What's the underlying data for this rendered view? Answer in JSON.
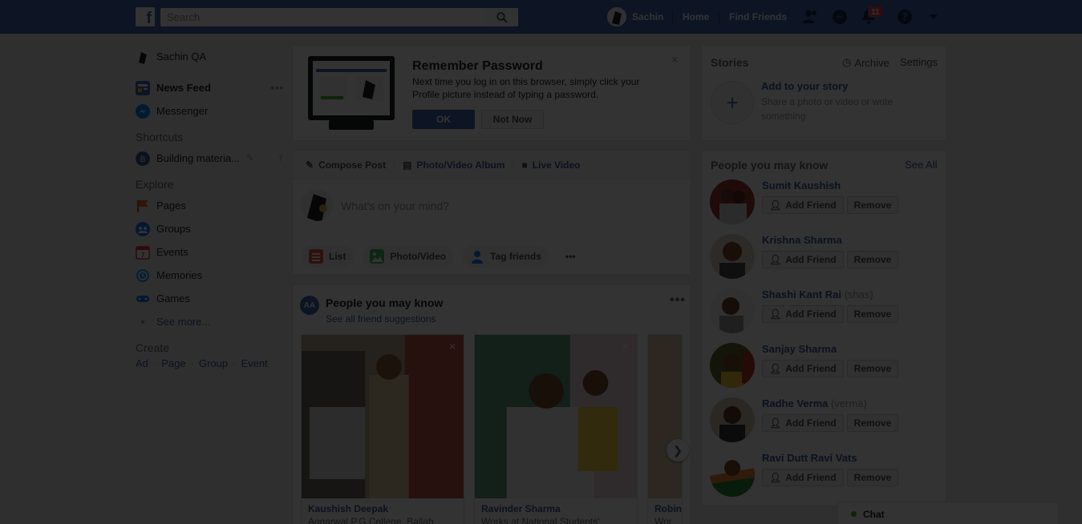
{
  "topbar": {
    "logo": "f",
    "search_placeholder": "Search",
    "user_name": "Sachin",
    "home": "Home",
    "find_friends": "Find Friends",
    "notifications_count": "11"
  },
  "left": {
    "profile_name": "Sachin QA",
    "news_feed": "News Feed",
    "news_feed_more": "•••",
    "messenger": "Messenger",
    "shortcuts_label": "Shortcuts",
    "shortcut_item": "Building materia...",
    "shortcut_count": "7",
    "explore_label": "Explore",
    "explore": [
      "Pages",
      "Groups",
      "Events",
      "Memories",
      "Games"
    ],
    "see_more": "See more...",
    "create_label": "Create",
    "create_links": [
      "Ad",
      "Page",
      "Group",
      "Event"
    ]
  },
  "remember_password": {
    "title": "Remember Password",
    "text": "Next time you log in on this browser, simply click your Profile picture instead of typing a password.",
    "ok": "OK",
    "not_now": "Not Now",
    "close": "×"
  },
  "composer": {
    "tabs": [
      "Compose Post",
      "Photo/Video Album",
      "Live Video"
    ],
    "placeholder": "What's on your mind?",
    "actions": [
      "List",
      "Photo/Video",
      "Tag friends"
    ],
    "more": "•••"
  },
  "pymk_feed": {
    "icon": "AA",
    "title": "People you may know",
    "subtitle": "See all friend suggestions",
    "more": "•••",
    "cards": [
      {
        "name": "Kaushish Deepak",
        "work": "Aggarwal P.G.College, Ballab"
      },
      {
        "name": "Ravinder Sharma",
        "work": "Works at National Students'"
      },
      {
        "name": "Robin",
        "work": "Wor"
      }
    ]
  },
  "stories": {
    "title": "Stories",
    "archive": "Archive",
    "settings": "Settings",
    "add_title": "Add to your story",
    "add_desc": "Share a photo or video or write something"
  },
  "pymk_right": {
    "title": "People you may know",
    "see_all": "See All",
    "add_friend": "Add Friend",
    "remove": "Remove",
    "people": [
      {
        "name": "Sumit Kaushish",
        "alias": ""
      },
      {
        "name": "Krishna Sharma",
        "alias": ""
      },
      {
        "name": "Shashi Kant Rai",
        "alias": "(shas)"
      },
      {
        "name": "Sanjay Sharma",
        "alias": ""
      },
      {
        "name": "Radhe Verma",
        "alias": "(verma)"
      },
      {
        "name": "Ravi Dutt Ravi Vats",
        "alias": ""
      }
    ]
  },
  "chat": {
    "label": "Chat"
  },
  "colors": {
    "brand": "#4267b2",
    "link": "#365899",
    "background": "#e9ebee",
    "overlay": "rgba(0,0,0,0.80)"
  }
}
